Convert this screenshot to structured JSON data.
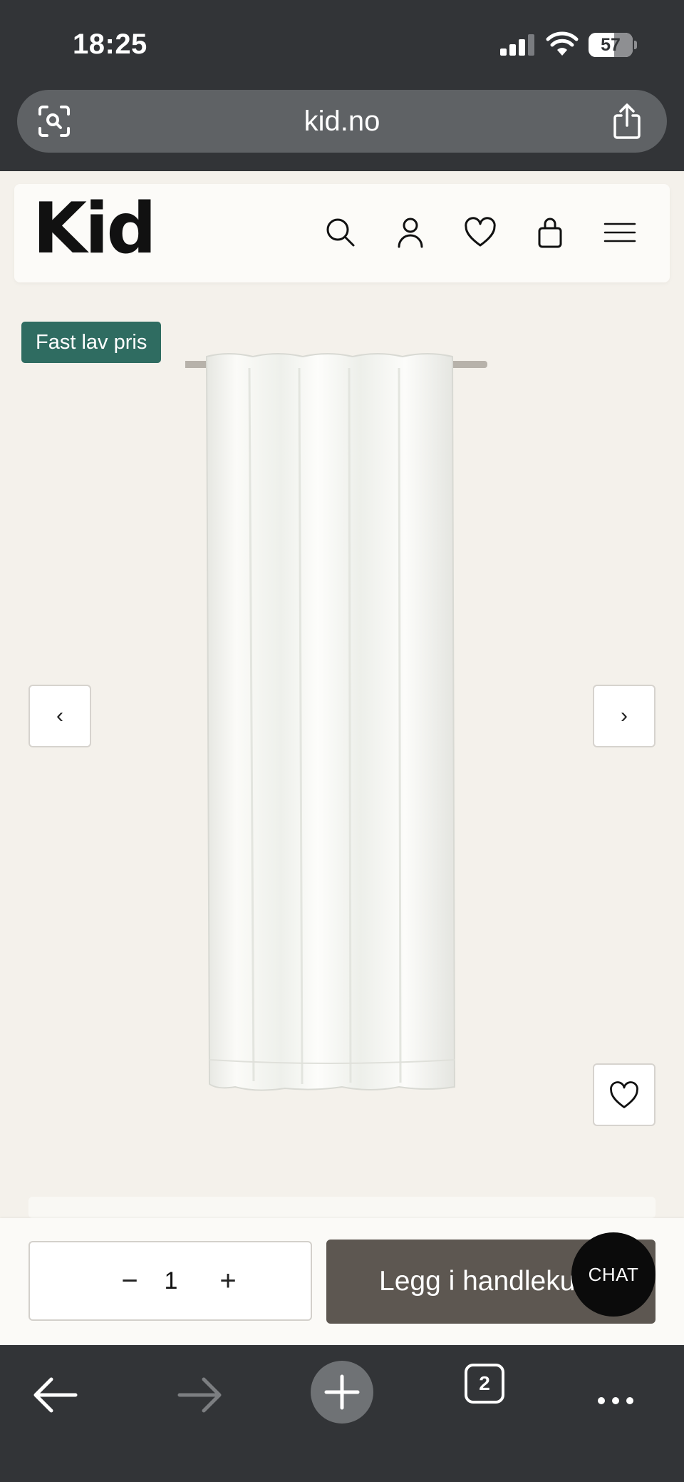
{
  "status_bar": {
    "time": "18:25",
    "battery": "57"
  },
  "browser": {
    "url": "kid.no",
    "tab_count": "2"
  },
  "site": {
    "logo": "Kid",
    "header_icons": [
      "search-icon",
      "account-icon",
      "heart-icon",
      "bag-icon",
      "menu-icon"
    ]
  },
  "product": {
    "badge": "Fast lav pris",
    "prev_label": "‹",
    "next_label": "›"
  },
  "purchase": {
    "quantity": "1",
    "minus_label": "−",
    "plus_label": "+",
    "add_to_cart_label": "Legg i handlekurv"
  },
  "chat": {
    "label": "CHAT"
  },
  "colors": {
    "browser_chrome": "#323437",
    "page_background": "#f4f1eb",
    "badge_green": "#2f6c61",
    "add_to_cart": "#5d5751"
  }
}
